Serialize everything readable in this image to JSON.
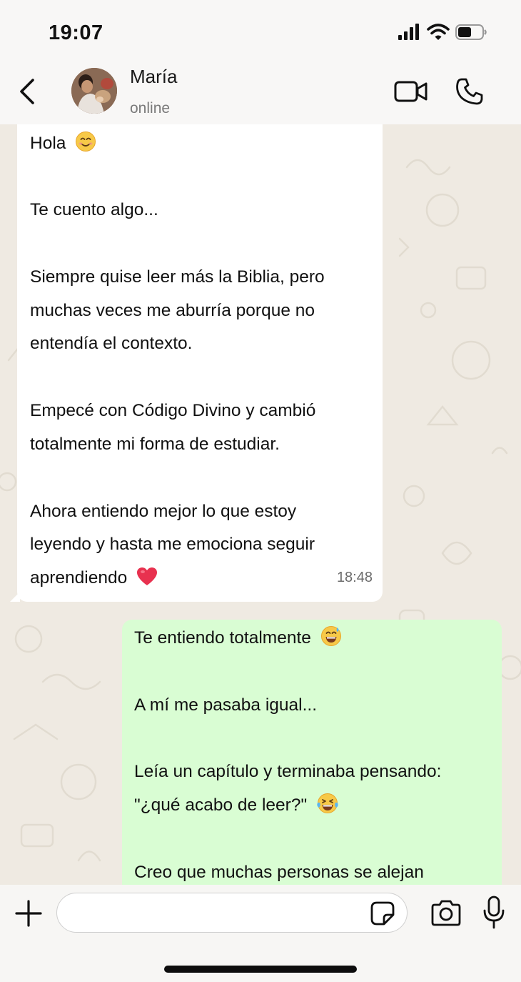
{
  "status_bar": {
    "time": "19:07"
  },
  "header": {
    "contact_name": "María",
    "contact_status": "online",
    "icons": [
      "back-chevron-icon",
      "video-camera-icon",
      "phone-icon"
    ]
  },
  "messages": {
    "incoming": {
      "lines": [
        "Hola",
        "Te cuento algo...",
        "Siempre quise leer más la Biblia, pero",
        "muchas veces me aburría porque no",
        "entendía el contexto.",
        "Empecé con Código Divino y cambió",
        "totalmente mi forma de estudiar.",
        "Ahora entiendo mejor lo que estoy",
        "leyendo y hasta me emociona seguir",
        "aprendiendo"
      ],
      "time": "18:48"
    },
    "outgoing": {
      "lines": [
        "Te entiendo totalmente",
        "A mí me pasaba igual...",
        "Leía un capítulo y terminaba pensando:",
        "\"¿qué acabo de leer?\"",
        "Creo que muchas personas se alejan"
      ]
    }
  },
  "emojis": {
    "smiling_face": "smiling-face-emoji",
    "heart": "red-heart-emoji",
    "grinning_sweat": "grinning-sweat-emoji",
    "tears_of_joy": "tears-of-joy-emoji"
  },
  "input": {
    "value": "",
    "icons": [
      "plus-icon",
      "sticker-icon",
      "camera-icon",
      "microphone-icon"
    ]
  },
  "colors": {
    "incoming_bubble": "#ffffff",
    "outgoing_bubble": "#d9fdd3",
    "chat_background": "#efeae2",
    "header_background": "#f8f7f6"
  }
}
